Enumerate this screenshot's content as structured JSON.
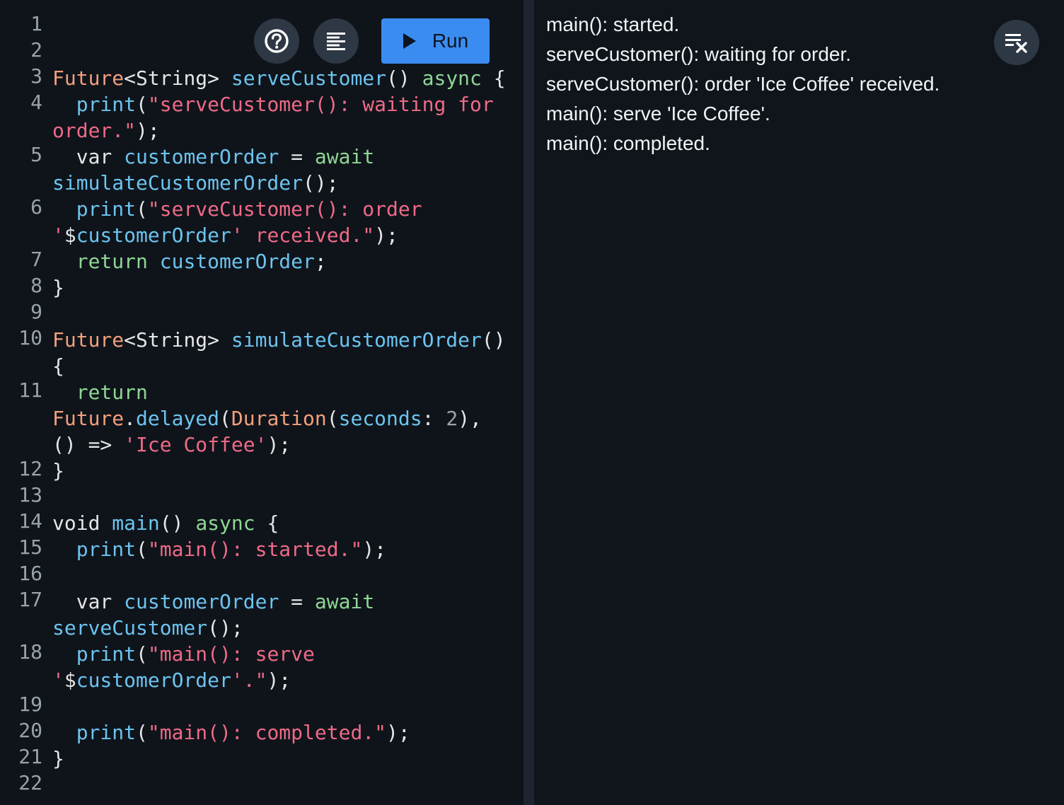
{
  "toolbar": {
    "help_icon": "help-circle-icon",
    "format_icon": "format-align-icon",
    "run_label": "Run",
    "run_icon": "play-icon"
  },
  "editor": {
    "lines": [
      {
        "num": "1",
        "tokens": []
      },
      {
        "num": "2",
        "tokens": []
      },
      {
        "num": "3",
        "tokens": [
          {
            "c": "t",
            "v": "Future"
          },
          {
            "c": "p",
            "v": "<String> "
          },
          {
            "c": "f",
            "v": "serveCustomer"
          },
          {
            "c": "p",
            "v": "() "
          },
          {
            "c": "k",
            "v": "async"
          },
          {
            "c": "p",
            "v": " {"
          }
        ]
      },
      {
        "num": "4",
        "tokens": [
          {
            "c": "p",
            "v": "  "
          },
          {
            "c": "f",
            "v": "print"
          },
          {
            "c": "p",
            "v": "("
          },
          {
            "c": "s",
            "v": "\"serveCustomer(): waiting for order.\""
          },
          {
            "c": "p",
            "v": ");"
          }
        ]
      },
      {
        "num": "5",
        "tokens": [
          {
            "c": "p",
            "v": "  var "
          },
          {
            "c": "f",
            "v": "customerOrder"
          },
          {
            "c": "p",
            "v": " = "
          },
          {
            "c": "k",
            "v": "await"
          },
          {
            "c": "p",
            "v": " "
          },
          {
            "c": "f",
            "v": "simulateCustomerOrder"
          },
          {
            "c": "p",
            "v": "();"
          }
        ]
      },
      {
        "num": "6",
        "tokens": [
          {
            "c": "p",
            "v": "  "
          },
          {
            "c": "f",
            "v": "print"
          },
          {
            "c": "p",
            "v": "("
          },
          {
            "c": "s",
            "v": "\"serveCustomer(): order '"
          },
          {
            "c": "p",
            "v": "$"
          },
          {
            "c": "f",
            "v": "customerOrder"
          },
          {
            "c": "s",
            "v": "' received.\""
          },
          {
            "c": "p",
            "v": ");"
          }
        ]
      },
      {
        "num": "7",
        "tokens": [
          {
            "c": "p",
            "v": "  "
          },
          {
            "c": "k",
            "v": "return"
          },
          {
            "c": "p",
            "v": " "
          },
          {
            "c": "f",
            "v": "customerOrder"
          },
          {
            "c": "p",
            "v": ";"
          }
        ]
      },
      {
        "num": "8",
        "tokens": [
          {
            "c": "p",
            "v": "}"
          }
        ]
      },
      {
        "num": "9",
        "tokens": []
      },
      {
        "num": "10",
        "tokens": [
          {
            "c": "t",
            "v": "Future"
          },
          {
            "c": "p",
            "v": "<String> "
          },
          {
            "c": "f",
            "v": "simulateCustomerOrder"
          },
          {
            "c": "p",
            "v": "() {"
          }
        ]
      },
      {
        "num": "11",
        "tokens": [
          {
            "c": "p",
            "v": "  "
          },
          {
            "c": "k",
            "v": "return"
          },
          {
            "c": "p",
            "v": " "
          },
          {
            "c": "t",
            "v": "Future"
          },
          {
            "c": "p",
            "v": "."
          },
          {
            "c": "f",
            "v": "delayed"
          },
          {
            "c": "p",
            "v": "("
          },
          {
            "c": "t",
            "v": "Duration"
          },
          {
            "c": "p",
            "v": "("
          },
          {
            "c": "f",
            "v": "seconds"
          },
          {
            "c": "p",
            "v": ": "
          },
          {
            "c": "n",
            "v": "2"
          },
          {
            "c": "p",
            "v": "), () => "
          },
          {
            "c": "s",
            "v": "'Ice Coffee'"
          },
          {
            "c": "p",
            "v": ");"
          }
        ]
      },
      {
        "num": "12",
        "tokens": [
          {
            "c": "p",
            "v": "}"
          }
        ]
      },
      {
        "num": "13",
        "tokens": []
      },
      {
        "num": "14",
        "tokens": [
          {
            "c": "p",
            "v": "void "
          },
          {
            "c": "f",
            "v": "main"
          },
          {
            "c": "p",
            "v": "() "
          },
          {
            "c": "k",
            "v": "async"
          },
          {
            "c": "p",
            "v": " {"
          }
        ]
      },
      {
        "num": "15",
        "tokens": [
          {
            "c": "p",
            "v": "  "
          },
          {
            "c": "f",
            "v": "print"
          },
          {
            "c": "p",
            "v": "("
          },
          {
            "c": "s",
            "v": "\"main(): started.\""
          },
          {
            "c": "p",
            "v": ");"
          }
        ]
      },
      {
        "num": "16",
        "tokens": []
      },
      {
        "num": "17",
        "tokens": [
          {
            "c": "p",
            "v": "  var "
          },
          {
            "c": "f",
            "v": "customerOrder"
          },
          {
            "c": "p",
            "v": " = "
          },
          {
            "c": "k",
            "v": "await"
          },
          {
            "c": "p",
            "v": " "
          },
          {
            "c": "f",
            "v": "serveCustomer"
          },
          {
            "c": "p",
            "v": "();"
          }
        ]
      },
      {
        "num": "18",
        "tokens": [
          {
            "c": "p",
            "v": "  "
          },
          {
            "c": "f",
            "v": "print"
          },
          {
            "c": "p",
            "v": "("
          },
          {
            "c": "s",
            "v": "\"main(): serve '"
          },
          {
            "c": "p",
            "v": "$"
          },
          {
            "c": "f",
            "v": "customerOrder"
          },
          {
            "c": "s",
            "v": "'.\""
          },
          {
            "c": "p",
            "v": ");"
          }
        ]
      },
      {
        "num": "19",
        "tokens": []
      },
      {
        "num": "20",
        "tokens": [
          {
            "c": "p",
            "v": "  "
          },
          {
            "c": "f",
            "v": "print"
          },
          {
            "c": "p",
            "v": "("
          },
          {
            "c": "s",
            "v": "\"main(): completed.\""
          },
          {
            "c": "p",
            "v": ");"
          }
        ]
      },
      {
        "num": "21",
        "tokens": [
          {
            "c": "p",
            "v": "}"
          }
        ]
      },
      {
        "num": "22",
        "tokens": []
      }
    ]
  },
  "console": {
    "clear_icon": "clear-console-icon",
    "lines": [
      "main(): started.",
      "serveCustomer(): waiting for order.",
      "serveCustomer(): order 'Ice Coffee' received.",
      "main(): serve 'Ice Coffee'.",
      "main(): completed."
    ]
  },
  "colors": {
    "run_button": "#3b8cf0",
    "keyword": "#8fd694",
    "type": "#f2a07b",
    "identifier": "#6cc4ef",
    "string": "#ef6a86"
  }
}
